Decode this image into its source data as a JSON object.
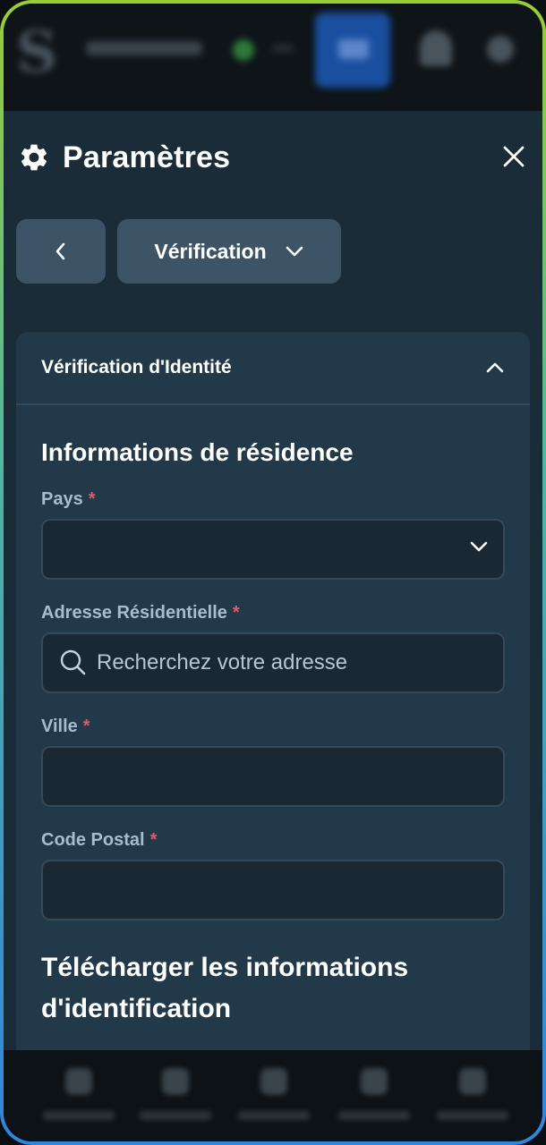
{
  "panel": {
    "title": "Paramètres",
    "section_selector": "Vérification"
  },
  "card": {
    "title": "Vérification d'Identité",
    "residence_heading": "Informations de résidence",
    "fields": {
      "country": {
        "label": "Pays",
        "required": "*",
        "value": ""
      },
      "address": {
        "label": "Adresse Résidentielle",
        "required": "*",
        "placeholder": "Recherchez votre adresse"
      },
      "city": {
        "label": "Ville",
        "required": "*",
        "value": ""
      },
      "postal": {
        "label": "Code Postal",
        "required": "*",
        "value": ""
      }
    },
    "upload_heading": "Télécharger les informations d'identification"
  },
  "colors": {
    "accent_required": "#e05a6a",
    "panel_bg": "#1b2c39",
    "card_bg": "#22394a",
    "button_bg": "#3d5467"
  },
  "icons": {
    "settings": "gear-icon",
    "close": "close-icon",
    "back": "chevron-left-icon",
    "dropdown": "chevron-down-icon",
    "collapse": "chevron-up-icon",
    "search": "search-icon"
  }
}
